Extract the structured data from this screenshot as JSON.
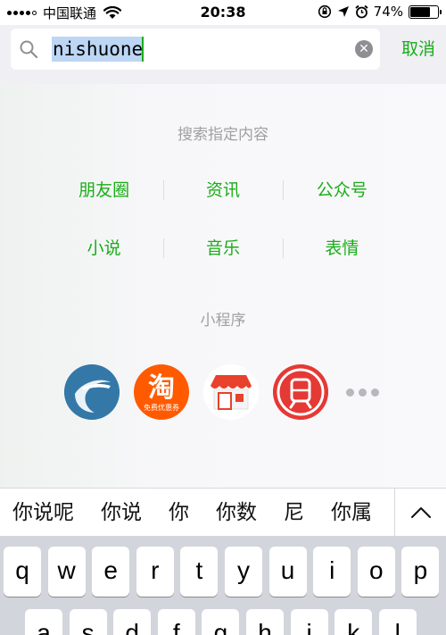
{
  "status_bar": {
    "carrier": "中国联通",
    "time": "20:38",
    "battery_percent": "74%",
    "battery_level": 0.74,
    "icons": [
      "signal-icon",
      "wifi-icon",
      "screen-lock-rotation-icon",
      "location-arrow-icon",
      "alarm-icon",
      "battery-icon"
    ]
  },
  "search": {
    "value": "nishuone",
    "cancel_label": "取消",
    "icons": [
      "search-icon",
      "clear-icon"
    ]
  },
  "scopes": {
    "title": "搜索指定内容",
    "row1": [
      "朋友圈",
      "资讯",
      "公众号"
    ],
    "row2": [
      "小说",
      "音乐",
      "表情"
    ]
  },
  "mini_programs": {
    "title": "小程序",
    "taobao_char": "淘",
    "taobao_caption": "免费优惠券",
    "icons": [
      "blue-swoosh-app-icon",
      "taobao-coupon-app-icon",
      "shop-app-icon",
      "metro-app-icon",
      "more-icon"
    ]
  },
  "candidates": [
    "你说呢",
    "你说",
    "你",
    "你数",
    "尼",
    "你属"
  ],
  "keyboard": {
    "row1": [
      "q",
      "w",
      "e",
      "r",
      "t",
      "y",
      "u",
      "i",
      "o",
      "p"
    ],
    "row2": [
      "a",
      "s",
      "d",
      "f",
      "g",
      "h",
      "j",
      "k",
      "l"
    ]
  },
  "colors": {
    "accent_green": "#1aad19",
    "selection": "#bcd6f4",
    "taobao_orange": "#ff5a00",
    "metro_red": "#e53935",
    "shop_red": "#e8412c",
    "blue_app": "#3d86b4"
  }
}
